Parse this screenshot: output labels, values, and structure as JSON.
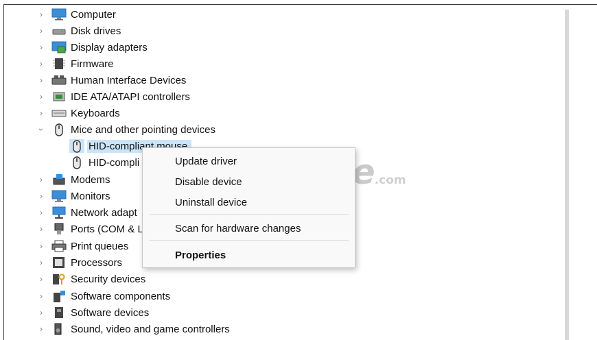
{
  "tree": {
    "items": [
      {
        "label": "Computer",
        "icon": "monitor-icon",
        "expanded": false
      },
      {
        "label": "Disk drives",
        "icon": "disk-drive-icon",
        "expanded": false
      },
      {
        "label": "Display adapters",
        "icon": "display-adapter-icon",
        "expanded": false
      },
      {
        "label": "Firmware",
        "icon": "firmware-icon",
        "expanded": false
      },
      {
        "label": "Human Interface Devices",
        "icon": "hid-icon",
        "expanded": false
      },
      {
        "label": "IDE ATA/ATAPI controllers",
        "icon": "ide-controller-icon",
        "expanded": false
      },
      {
        "label": "Keyboards",
        "icon": "keyboard-icon",
        "expanded": false
      },
      {
        "label": "Mice and other pointing devices",
        "icon": "mouse-icon",
        "expanded": true
      },
      {
        "label": "Modems",
        "icon": "modem-icon",
        "expanded": false
      },
      {
        "label": "Monitors",
        "icon": "monitor-icon",
        "expanded": false
      },
      {
        "label": "Network adapt",
        "icon": "network-adapter-icon",
        "expanded": false
      },
      {
        "label": "Ports (COM & L",
        "icon": "port-icon",
        "expanded": false
      },
      {
        "label": "Print queues",
        "icon": "printer-icon",
        "expanded": false
      },
      {
        "label": "Processors",
        "icon": "processor-icon",
        "expanded": false
      },
      {
        "label": "Security devices",
        "icon": "security-device-icon",
        "expanded": false
      },
      {
        "label": "Software components",
        "icon": "software-component-icon",
        "expanded": false
      },
      {
        "label": "Software devices",
        "icon": "software-device-icon",
        "expanded": false
      },
      {
        "label": "Sound, video and game controllers",
        "icon": "speaker-icon",
        "expanded": false
      }
    ],
    "children": [
      {
        "label": "HID-compliant mouse",
        "icon": "mouse-icon",
        "selected": true
      },
      {
        "label": "HID-compli",
        "icon": "mouse-icon",
        "selected": false
      }
    ]
  },
  "context_menu": {
    "update": "Update driver",
    "disable": "Disable device",
    "uninstall": "Uninstall device",
    "scan": "Scan for hardware changes",
    "properties": "Properties"
  },
  "watermark": {
    "main": "TipsMake",
    "suffix": ".com"
  },
  "colors": {
    "selection": "#cce4f7",
    "menu_bg": "#f9f9f9",
    "icon_blue": "#3b8ed8"
  }
}
